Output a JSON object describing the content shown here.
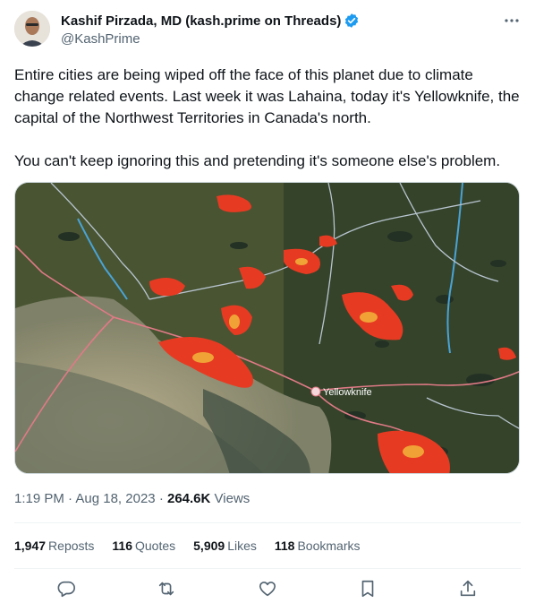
{
  "author": {
    "display_name": "Kashif Pirzada, MD (kash.prime on Threads)",
    "handle": "@KashPrime"
  },
  "tweet": {
    "paragraph_1": "Entire cities are being wiped off the face of this planet due to climate change related events. Last week it was Lahaina, today it's Yellowknife, the capital of the Northwest Territories in Canada's north.",
    "paragraph_2": "You can't keep ignoring this and pretending it's someone else's problem."
  },
  "map": {
    "city_label": "Yellowknife"
  },
  "meta": {
    "time": "1:19 PM",
    "separator": "·",
    "date": "Aug 18, 2023",
    "views_count": "264.6K",
    "views_label": "Views"
  },
  "stats": {
    "reposts_count": "1,947",
    "reposts_label": "Reposts",
    "quotes_count": "116",
    "quotes_label": "Quotes",
    "likes_count": "5,909",
    "likes_label": "Likes",
    "bookmarks_count": "118",
    "bookmarks_label": "Bookmarks"
  },
  "icons": {
    "verified": "verified-badge-icon",
    "more": "more-icon",
    "reply": "reply-icon",
    "repost": "repost-icon",
    "like": "like-icon",
    "bookmark": "bookmark-icon",
    "share": "share-icon"
  },
  "colors": {
    "accent": "#1d9bf0",
    "text": "#0f1419",
    "muted": "#536471",
    "fire": "#e63b22"
  }
}
